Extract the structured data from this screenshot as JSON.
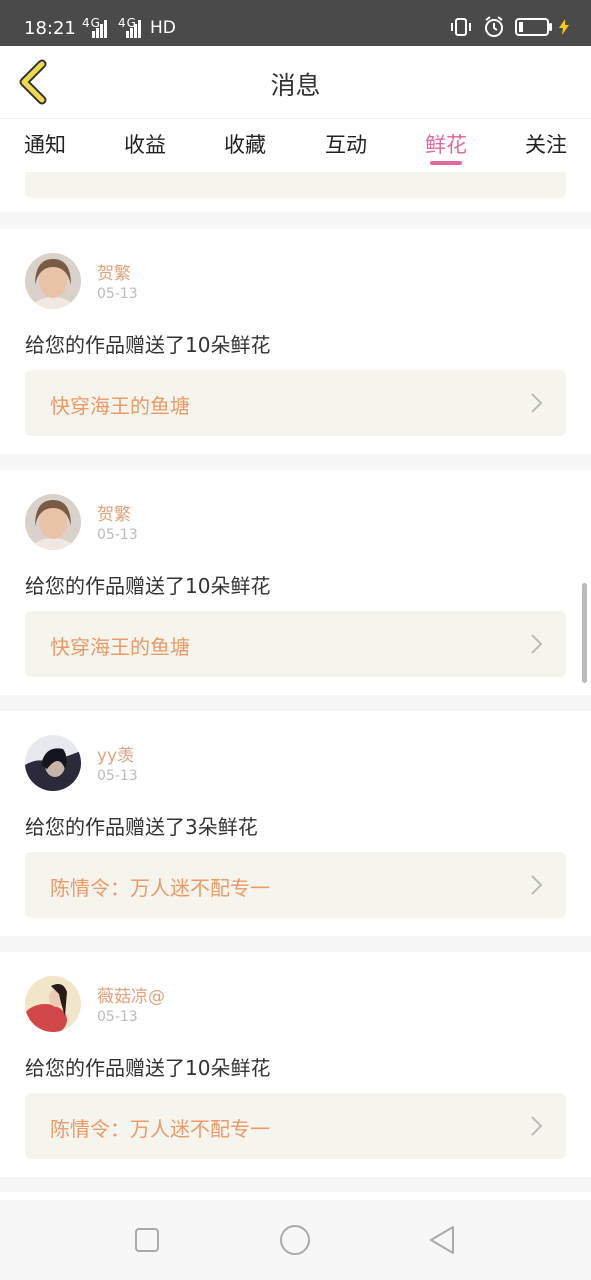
{
  "status": {
    "time": "18:21",
    "net1": "4G",
    "net2": "4G",
    "hd": "HD"
  },
  "header": {
    "title": "消息"
  },
  "tabs": [
    {
      "label": "通知"
    },
    {
      "label": "收益"
    },
    {
      "label": "收藏"
    },
    {
      "label": "互动"
    },
    {
      "label": "鲜花",
      "active": true
    },
    {
      "label": "关注"
    }
  ],
  "items": [
    {
      "name": "贺繁",
      "date": "05-13",
      "message": "给您的作品赠送了10朵鲜花",
      "work": "快穿海王的鱼塘"
    },
    {
      "name": "贺繁",
      "date": "05-13",
      "message": "给您的作品赠送了10朵鲜花",
      "work": "快穿海王的鱼塘"
    },
    {
      "name": "yy羡",
      "date": "05-13",
      "message": "给您的作品赠送了3朵鲜花",
      "work": "陈情令：万人迷不配专一"
    },
    {
      "name": "薇菇凉@",
      "date": "05-13",
      "message": "给您的作品赠送了10朵鲜花",
      "work": "陈情令：万人迷不配专一"
    }
  ],
  "colors": {
    "accent": "#e36aa0",
    "name": "#e2a27c",
    "work_title": "#ec9a67",
    "work_bg": "#f5f5ee"
  }
}
